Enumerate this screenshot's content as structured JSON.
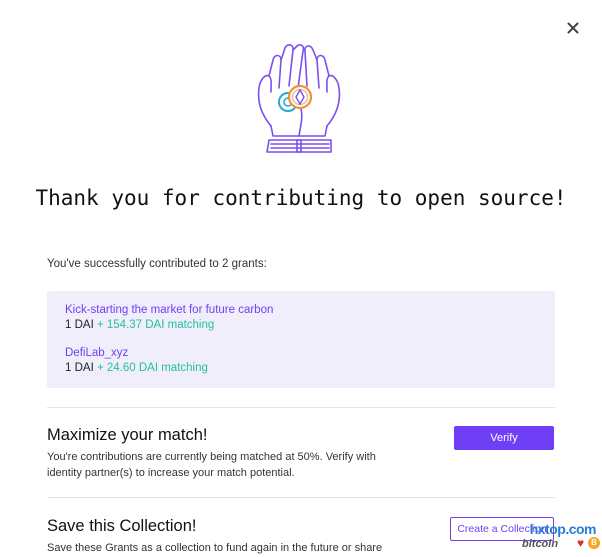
{
  "modal": {
    "close_icon": "close-icon",
    "illustration_icon": "hands-with-coins-illustration",
    "title": "Thank you for contributing to open source!",
    "subtitle": "You've successfully contributed to 2 grants:"
  },
  "grants": [
    {
      "name": "Kick-starting the market for future carbon",
      "amount": "1 DAI",
      "match": "+ 154.37 DAI matching"
    },
    {
      "name": "DefiLab_xyz",
      "amount": "1 DAI",
      "match": "+ 24.60 DAI matching"
    }
  ],
  "maximize": {
    "title": "Maximize your match!",
    "text": "You're contributions are currently being matched at 50%. Verify with identity partner(s) to increase your match potential.",
    "button_label": "Verify"
  },
  "collection": {
    "title": "Save this Collection!",
    "text": "Save these Grants as a collection to fund again in the future or share",
    "button_label": "Create a Collection"
  },
  "watermark": {
    "main": "hxtop.com",
    "sub": "bitcoin",
    "coin": "B"
  },
  "colors": {
    "accent": "#6f3ff5",
    "match_green": "#23c0a2",
    "grants_bg": "#f1eefc"
  }
}
